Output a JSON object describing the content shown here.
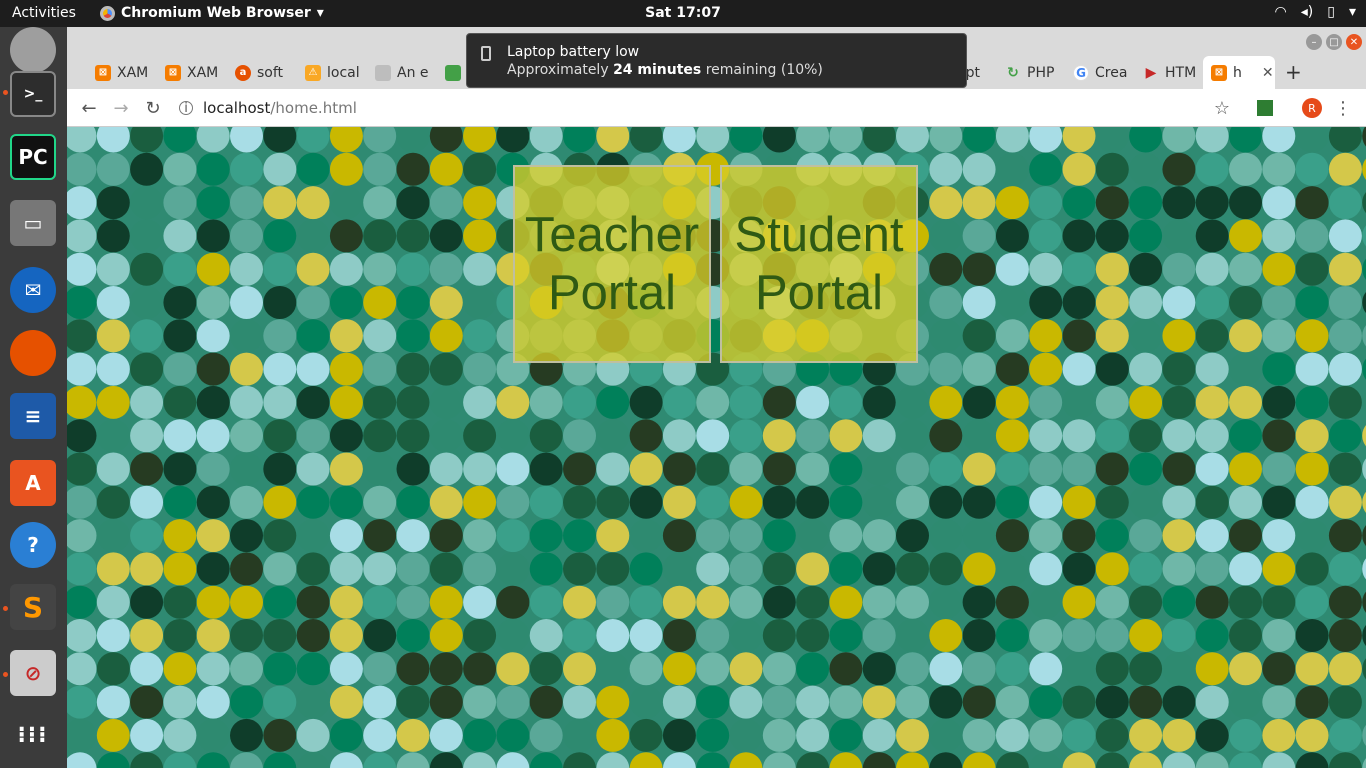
{
  "topbar": {
    "activities": "Activities",
    "app_name": "Chromium Web Browser",
    "clock": "Sat 17:07"
  },
  "notification": {
    "title": "Laptop battery low",
    "body_prefix": "Approximately ",
    "body_bold": "24 minutes",
    "body_suffix": " remaining (10%)"
  },
  "tabs": [
    {
      "label": "XAM",
      "icon": "xampp-icon",
      "color": "#f57c00"
    },
    {
      "label": "XAM",
      "icon": "xampp-icon",
      "color": "#f57c00"
    },
    {
      "label": "soft",
      "icon": "askubuntu-icon",
      "color": "#e65100"
    },
    {
      "label": "local",
      "icon": "phpmyadmin-icon",
      "color": "#f9a825"
    },
    {
      "label": "An e",
      "icon": "document-icon",
      "color": "#9e9e9e"
    },
    {
      "label": "",
      "icon": "green-icon",
      "color": "#43a047"
    },
    {
      "label": "opt",
      "icon": "generic-icon",
      "color": "#9e9e9e"
    },
    {
      "label": "PHP",
      "icon": "refresh-green-icon",
      "color": "#43a047"
    },
    {
      "label": "Crea",
      "icon": "google-icon",
      "color": "#4285f4"
    },
    {
      "label": "HTM",
      "icon": "play-red-icon",
      "color": "#c62828"
    },
    {
      "label": "h",
      "icon": "xampp-icon",
      "color": "#f57c00"
    }
  ],
  "address": {
    "host": "localhost",
    "path": "/home.html"
  },
  "profile_initial": "R",
  "portals": {
    "teacher": "Teacher Portal",
    "student": "Student Portal"
  }
}
